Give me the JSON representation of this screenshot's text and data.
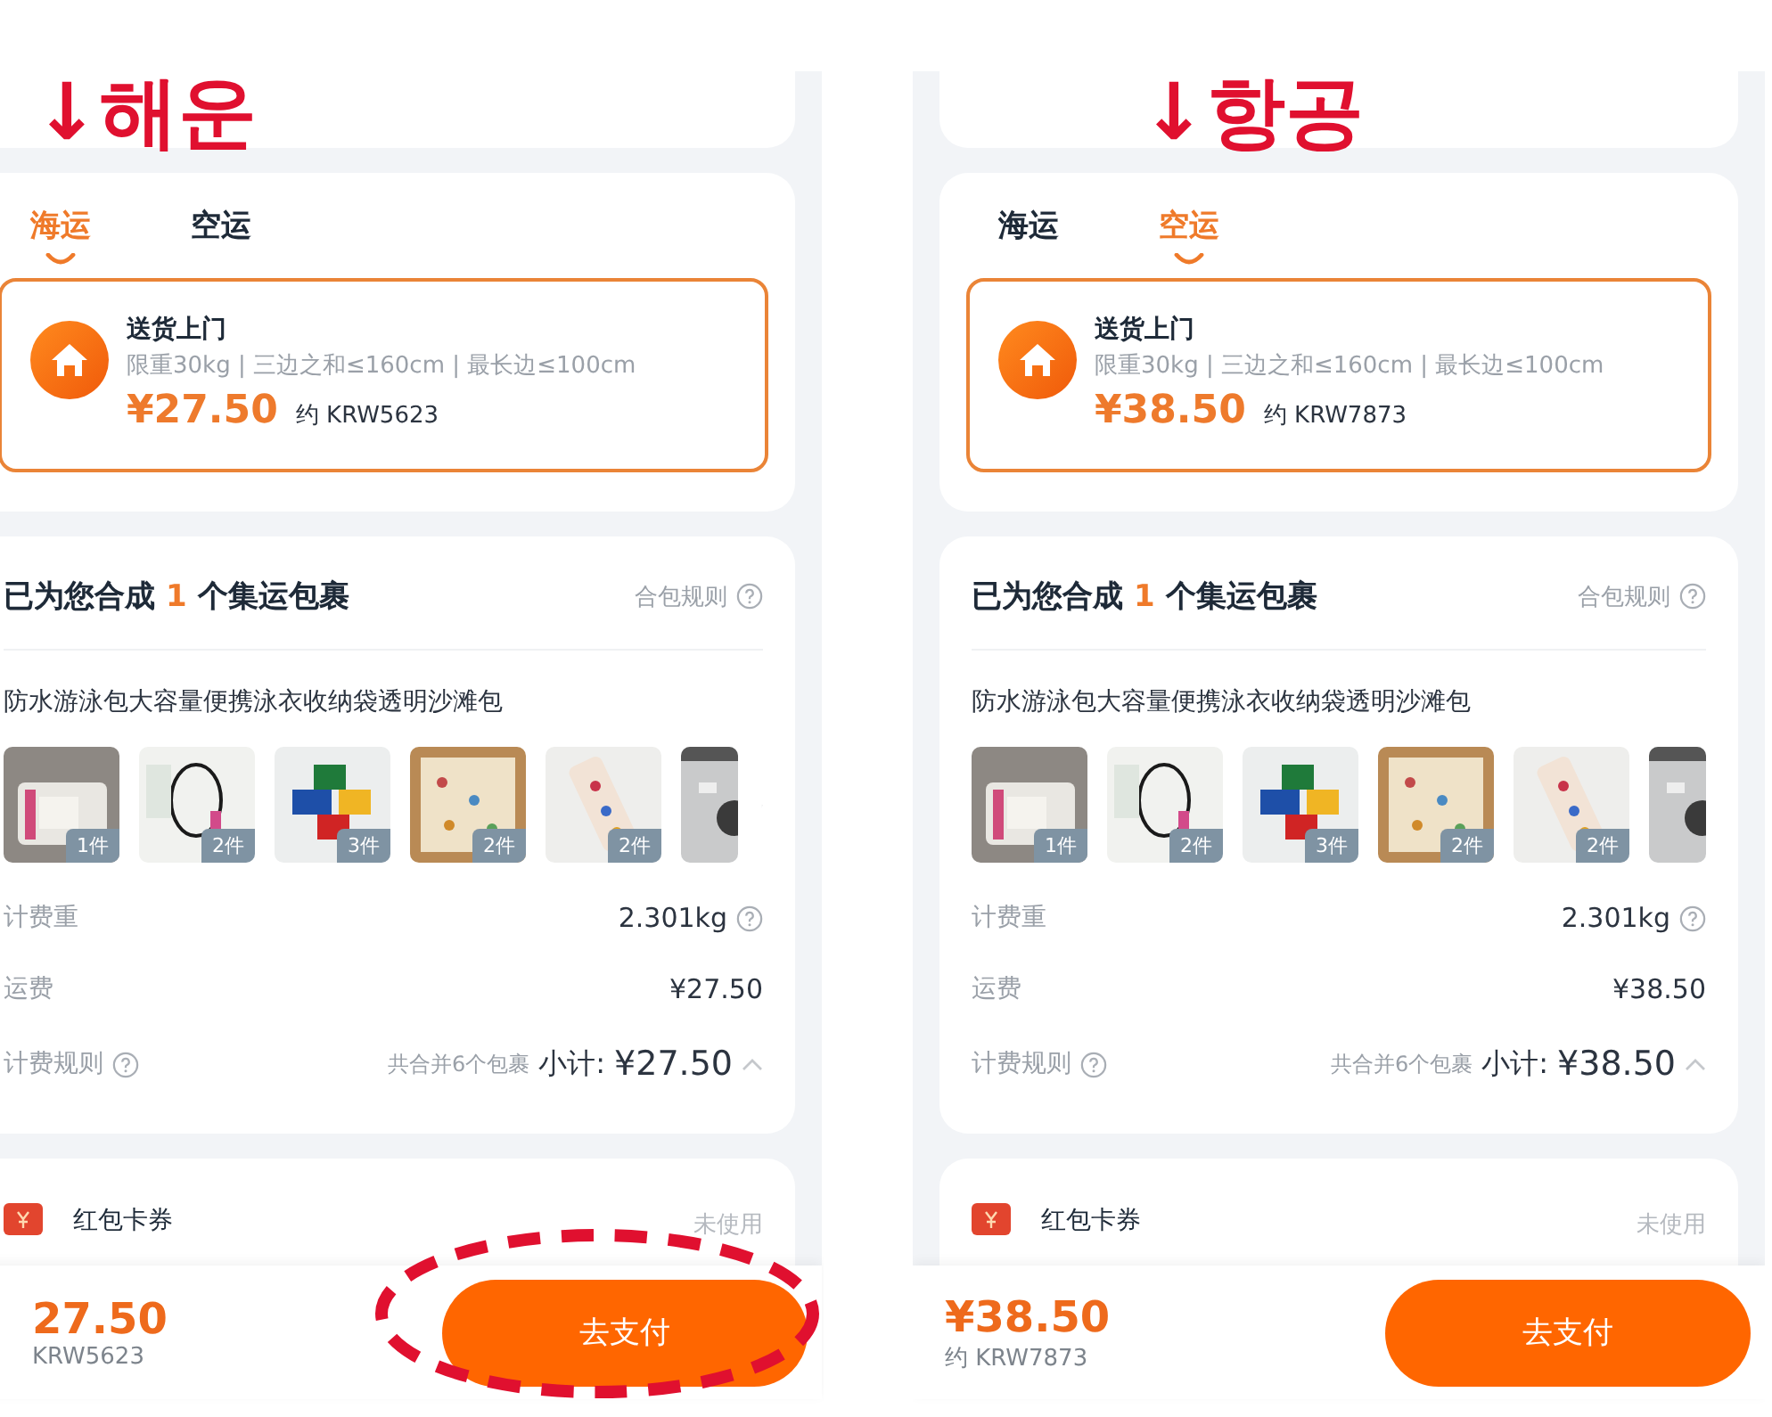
{
  "panels": [
    {
      "annotation": "↓해운",
      "tabs": [
        {
          "label": "海运",
          "selected": true
        },
        {
          "label": "空运",
          "selected": false
        }
      ],
      "delivery": {
        "title": "送货上门",
        "limits": "限重30kg | 三边之和≤160cm | 最长边≤100cm",
        "price": "¥27.50",
        "approx": "约 KRW5623"
      },
      "package": {
        "heading_before": "已为您合成",
        "count": "1",
        "heading_after": "个集运包裹",
        "rule_link": "合包规则",
        "product_title": "防水游泳包大容量便携泳衣收纳袋透明沙滩包",
        "thumbnails": [
          {
            "kind": "full",
            "count": "1件"
          },
          {
            "kind": "full",
            "count": "2件"
          },
          {
            "kind": "full",
            "count": "3件"
          },
          {
            "kind": "full",
            "count": "2件"
          },
          {
            "kind": "full",
            "count": "2件"
          },
          {
            "kind": "partial"
          }
        ],
        "rows": [
          {
            "kind": "weight",
            "label": "计费重",
            "value": "2.301kg"
          },
          {
            "kind": "fee",
            "label": "运费",
            "value": "¥27.50"
          },
          {
            "kind": "rule",
            "label": "计费规则",
            "note": "共合并6个包裹",
            "subtotal_label": "小计:",
            "subtotal": "¥27.50"
          }
        ]
      },
      "coupon": {
        "label": "红包卡券",
        "value": "未使用"
      },
      "footer": {
        "price": "27.50",
        "approx": "KRW5623",
        "button": "去支付",
        "circled": true
      }
    },
    {
      "annotation": "↓항공",
      "tabs": [
        {
          "label": "海运",
          "selected": false
        },
        {
          "label": "空运",
          "selected": true
        }
      ],
      "delivery": {
        "title": "送货上门",
        "limits": "限重30kg | 三边之和≤160cm | 最长边≤100cm",
        "price": "¥38.50",
        "approx": "约 KRW7873"
      },
      "package": {
        "heading_before": "已为您合成",
        "count": "1",
        "heading_after": "个集运包裹",
        "rule_link": "合包规则",
        "product_title": "防水游泳包大容量便携泳衣收纳袋透明沙滩包",
        "thumbnails": [
          {
            "kind": "full",
            "count": "1件"
          },
          {
            "kind": "full",
            "count": "2件"
          },
          {
            "kind": "full",
            "count": "3件"
          },
          {
            "kind": "full",
            "count": "2件"
          },
          {
            "kind": "full",
            "count": "2件"
          },
          {
            "kind": "partial"
          }
        ],
        "rows": [
          {
            "kind": "weight",
            "label": "计费重",
            "value": "2.301kg"
          },
          {
            "kind": "fee",
            "label": "运费",
            "value": "¥38.50"
          },
          {
            "kind": "rule",
            "label": "计费规则",
            "note": "共合并6个包裹",
            "subtotal_label": "小计:",
            "subtotal": "¥38.50"
          }
        ]
      },
      "coupon": {
        "label": "红包卡券",
        "value": "未使用"
      },
      "footer": {
        "price": "¥38.50",
        "approx": "约 KRW7873",
        "button": "去支付",
        "circled": false
      }
    }
  ]
}
